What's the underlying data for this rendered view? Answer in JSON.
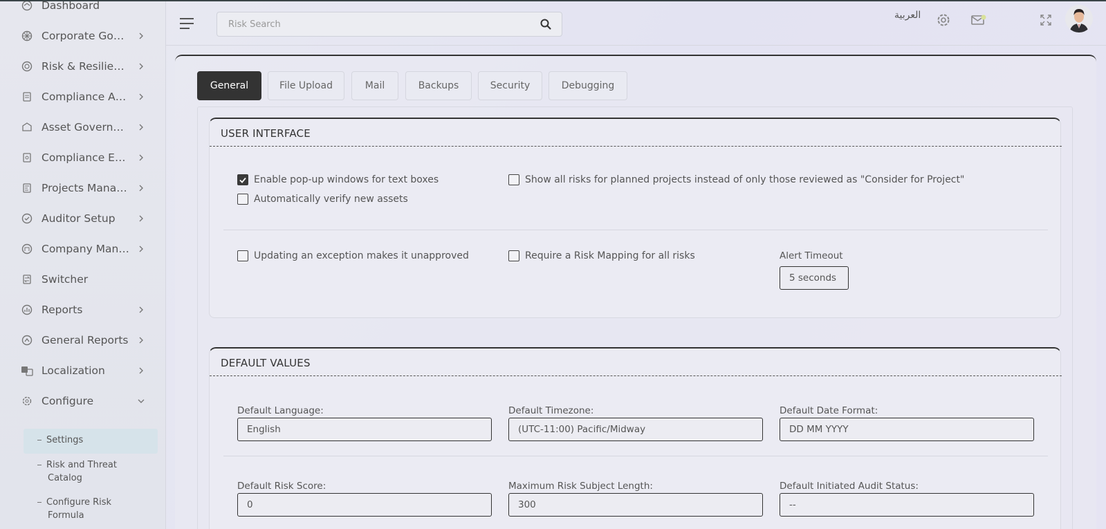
{
  "sidebar": {
    "items": [
      {
        "label": "Dashboard",
        "icon": "dashboard-icon",
        "has_chevron": false
      },
      {
        "label": "Corporate Governance",
        "icon": "governance-icon",
        "has_chevron": true
      },
      {
        "label": "Risk & Resilience",
        "icon": "risk-icon",
        "has_chevron": true
      },
      {
        "label": "Compliance Assessment",
        "icon": "compliance-icon",
        "has_chevron": true
      },
      {
        "label": "Asset Governance",
        "icon": "asset-icon",
        "has_chevron": true
      },
      {
        "label": "Compliance Evidence",
        "icon": "evidence-icon",
        "has_chevron": true
      },
      {
        "label": "Projects Management",
        "icon": "projects-icon",
        "has_chevron": true
      },
      {
        "label": "Auditor Setup",
        "icon": "auditor-icon",
        "has_chevron": true
      },
      {
        "label": "Company Management",
        "icon": "company-icon",
        "has_chevron": true
      },
      {
        "label": "Switcher",
        "icon": "switcher-icon",
        "has_chevron": false
      },
      {
        "label": "Reports",
        "icon": "reports-icon",
        "has_chevron": true
      },
      {
        "label": "General Reports",
        "icon": "general-reports-icon",
        "has_chevron": true
      },
      {
        "label": "Localization",
        "icon": "localization-icon",
        "has_chevron": true
      },
      {
        "label": "Configure",
        "icon": "configure-icon",
        "has_chevron": true,
        "expanded": true
      }
    ],
    "sub_items": [
      {
        "label": "Settings",
        "active": true
      },
      {
        "label": "Risk and Threat Catalog",
        "line1": "Risk and Threat",
        "line2": "Catalog"
      },
      {
        "label": "Configure Risk Formula",
        "line1": "Configure Risk",
        "line2": "Formula"
      }
    ]
  },
  "header": {
    "search_placeholder": "Risk Search",
    "language_label": "العربية"
  },
  "tabs": [
    {
      "label": "General",
      "active": true
    },
    {
      "label": "File Upload"
    },
    {
      "label": "Mail"
    },
    {
      "label": "Backups"
    },
    {
      "label": "Security"
    },
    {
      "label": "Debugging"
    }
  ],
  "user_interface": {
    "title": "USER INTERFACE",
    "checkboxes": {
      "popup": {
        "label": "Enable pop-up windows for text boxes",
        "checked": true
      },
      "show_all_risks": {
        "label": "Show all risks for planned projects instead of only those reviewed as \"Consider for Project\"",
        "checked": false
      },
      "auto_verify": {
        "label": "Automatically verify new assets",
        "checked": false
      },
      "exception_unapproved": {
        "label": "Updating an exception makes it unapproved",
        "checked": false
      },
      "risk_mapping": {
        "label": "Require a Risk Mapping for all risks",
        "checked": false
      }
    },
    "alert_timeout": {
      "label": "Alert Timeout",
      "value": "5 seconds"
    }
  },
  "default_values": {
    "title": "DEFAULT VALUES",
    "language": {
      "label": "Default Language:",
      "value": "English"
    },
    "timezone": {
      "label": "Default Timezone:",
      "value": "(UTC-11:00) Pacific/Midway"
    },
    "date_format": {
      "label": "Default Date Format:",
      "value": "DD MM YYYY"
    },
    "risk_score": {
      "label": "Default Risk Score:",
      "value": "0"
    },
    "max_subject": {
      "label": "Maximum Risk Subject Length:",
      "value": "300"
    },
    "audit_status": {
      "label": "Default Initiated Audit Status:",
      "value": "--"
    }
  },
  "colors": {
    "accent": "#333333",
    "active_sub_bg": "#d6e3ea"
  }
}
